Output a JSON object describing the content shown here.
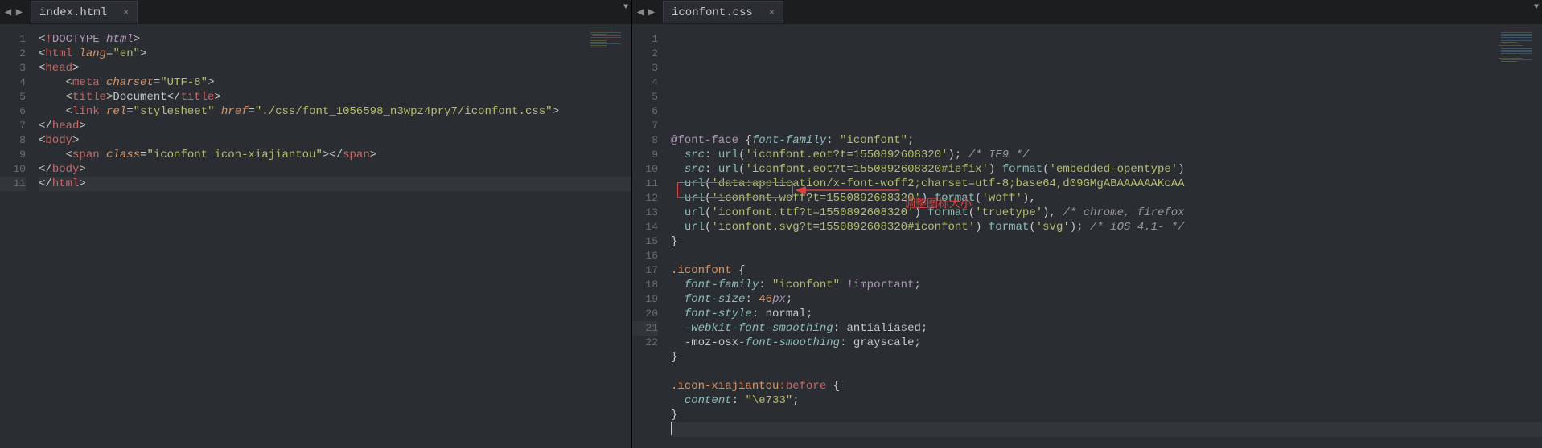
{
  "leftPane": {
    "tabName": "index.html",
    "lines": [
      {
        "n": "1",
        "html": "<span class='white'>&lt;</span><span class='red'>!</span><span class='purple'>DOCTYPE</span><span class='white'> </span><span class='purple ital'>html</span><span class='white'>&gt;</span>"
      },
      {
        "n": "2",
        "html": "<span class='white'>&lt;</span><span class='red'>html</span><span class='white'> </span><span class='orange ital'>lang</span><span class='white'>=</span><span class='green'>\"en\"</span><span class='white'>&gt;</span>"
      },
      {
        "n": "3",
        "html": "<span class='white'>&lt;</span><span class='red'>head</span><span class='white'>&gt;</span>"
      },
      {
        "n": "4",
        "html": "    <span class='white'>&lt;</span><span class='red'>meta</span><span class='white'> </span><span class='orange ital'>charset</span><span class='white'>=</span><span class='green'>\"UTF-8\"</span><span class='white'>&gt;</span>"
      },
      {
        "n": "5",
        "html": "    <span class='white'>&lt;</span><span class='red'>title</span><span class='white'>&gt;Document&lt;/</span><span class='red'>title</span><span class='white'>&gt;</span>"
      },
      {
        "n": "6",
        "html": "    <span class='white'>&lt;</span><span class='red'>link</span><span class='white'> </span><span class='orange ital'>rel</span><span class='white'>=</span><span class='green'>\"stylesheet\"</span><span class='white'> </span><span class='orange ital'>href</span><span class='white'>=</span><span class='green'>\"./css/font_1056598_n3wpz4pry7/iconfont.css\"</span><span class='white'>&gt;</span>"
      },
      {
        "n": "7",
        "html": "<span class='white'>&lt;/</span><span class='red'>head</span><span class='white'>&gt;</span>"
      },
      {
        "n": "8",
        "html": "<span class='white'>&lt;</span><span class='red'>body</span><span class='white'>&gt;</span>"
      },
      {
        "n": "9",
        "html": "    <span class='white'>&lt;</span><span class='red'>span</span><span class='white'> </span><span class='orange ital'>class</span><span class='white'>=</span><span class='green'>\"iconfont icon-xiajiantou\"</span><span class='white'>&gt;&lt;/</span><span class='red'>span</span><span class='white'>&gt;</span>"
      },
      {
        "n": "10",
        "html": "<span class='white'>&lt;/</span><span class='red'>body</span><span class='white'>&gt;</span>"
      },
      {
        "n": "11",
        "html": "<span class='white'>&lt;/</span><span class='red'>html</span><span class='white'>&gt;</span>",
        "current": true
      }
    ]
  },
  "rightPane": {
    "tabName": "iconfont.css",
    "lines": [
      {
        "n": "1",
        "html": "<span class='purple'>@font-face</span><span class='white'> {</span><span class='cyan ital'>font-family</span><span class='white'>: </span><span class='green'>\"iconfont\"</span><span class='white'>;</span>"
      },
      {
        "n": "2",
        "html": "  <span class='cyan ital'>src</span><span class='white'>: </span><span class='cyan'>url</span><span class='white'>(</span><span class='green'>'iconfont.eot?t=1550892608320'</span><span class='white'>); </span><span class='grey'>/* IE9 */</span>"
      },
      {
        "n": "3",
        "html": "  <span class='cyan ital'>src</span><span class='white'>: </span><span class='cyan'>url</span><span class='white'>(</span><span class='green'>'iconfont.eot?t=1550892608320#iefix'</span><span class='white'>) </span><span class='cyan'>format</span><span class='white'>(</span><span class='green'>'embedded-opentype'</span><span class='white'>)</span>"
      },
      {
        "n": "4",
        "html": "  <span class='cyan'>url</span><span class='white'>(</span><span class='green'>'data:application/x-font-woff2;charset=utf-8;base64,d09GMgABAAAAAAKcAA</span>"
      },
      {
        "n": "5",
        "html": "  <span class='cyan'>url</span><span class='white'>(</span><span class='green'>'iconfont.woff?t=1550892608320'</span><span class='white'>) </span><span class='cyan'>format</span><span class='white'>(</span><span class='green'>'woff'</span><span class='white'>),</span>"
      },
      {
        "n": "6",
        "html": "  <span class='cyan'>url</span><span class='white'>(</span><span class='green'>'iconfont.ttf?t=1550892608320'</span><span class='white'>) </span><span class='cyan'>format</span><span class='white'>(</span><span class='green'>'truetype'</span><span class='white'>), </span><span class='grey'>/* chrome, firefox</span>"
      },
      {
        "n": "7",
        "html": "  <span class='cyan'>url</span><span class='white'>(</span><span class='green'>'iconfont.svg?t=1550892608320#iconfont'</span><span class='white'>) </span><span class='cyan'>format</span><span class='white'>(</span><span class='green'>'svg'</span><span class='white'>); </span><span class='grey'>/* iOS 4.1- */</span>"
      },
      {
        "n": "8",
        "html": "<span class='white'>}</span>"
      },
      {
        "n": "9",
        "html": ""
      },
      {
        "n": "10",
        "html": "<span class='orange'>.iconfont</span><span class='white'> {</span>"
      },
      {
        "n": "11",
        "html": "  <span class='cyan ital'>font-family</span><span class='white'>: </span><span class='green'>\"iconfont\"</span><span class='white'> </span><span class='purple'>!important</span><span class='white'>;</span>"
      },
      {
        "n": "12",
        "html": "  <span class='cyan ital'>font-size</span><span class='white'>: </span><span class='orange'>46</span><span class='purple ital'>px</span><span class='white'>;</span>"
      },
      {
        "n": "13",
        "html": "  <span class='cyan ital'>font-style</span><span class='white'>: normal;</span>"
      },
      {
        "n": "14",
        "html": "  <span class='cyan ital'>-webkit-font-smoothing</span><span class='white'>: antialiased;</span>"
      },
      {
        "n": "15",
        "html": "  <span class='white'>-moz-</span><span class='white'>osx</span><span class='cyan ital'>-font-smoothing</span><span class='white'>: grayscale;</span>"
      },
      {
        "n": "16",
        "html": "<span class='white'>}</span>"
      },
      {
        "n": "17",
        "html": ""
      },
      {
        "n": "18",
        "html": "<span class='orange'>.icon-xiajiantou</span><span class='red'>:before</span><span class='white'> {</span>"
      },
      {
        "n": "19",
        "html": "  <span class='cyan ital'>content</span><span class='white'>: </span><span class='green'>\"\\e733\"</span><span class='white'>;</span>"
      },
      {
        "n": "20",
        "html": "<span class='white'>}</span>"
      },
      {
        "n": "21",
        "html": "<span class='cursor-line'></span>",
        "current": true
      },
      {
        "n": "22",
        "html": ""
      }
    ]
  },
  "annotation": {
    "text": "调整图标大小"
  },
  "glyphs": {
    "navLeft": "◀",
    "navRight": "▶",
    "close": "×",
    "dropdown": "▼"
  }
}
